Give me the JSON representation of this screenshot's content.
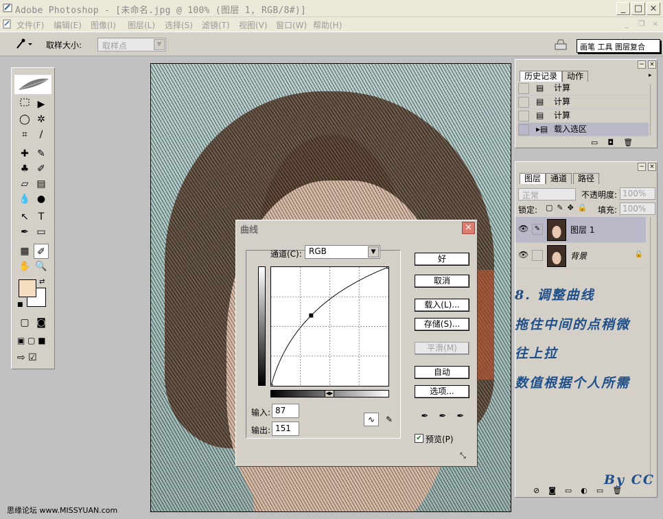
{
  "window": {
    "title": "Adobe Photoshop - [未命名.jpg @ 100% (图层 1, RGB/8#)]",
    "min_label": "_",
    "max_label": "□",
    "close_label": "×"
  },
  "menu": {
    "items": [
      "文件(F)",
      "编辑(E)",
      "图像(I)",
      "图层(L)",
      "选择(S)",
      "滤镜(T)",
      "视图(V)",
      "窗口(W)",
      "帮助(H)"
    ],
    "doc_controls": [
      "_",
      "❐",
      "×"
    ]
  },
  "options": {
    "sample_size_label": "取样大小:",
    "sample_size_value": "取样点",
    "well_tabs": "画笔 工具 图层复合"
  },
  "toolbox": {
    "colors": {
      "foreground": "#f5dcc0",
      "background": "#ffffff"
    }
  },
  "history": {
    "tabs": [
      "历史记录",
      "动作"
    ],
    "items": [
      "计算",
      "计算",
      "计算",
      "载入选区"
    ]
  },
  "layers": {
    "tabs": [
      "图层",
      "通道",
      "路径"
    ],
    "blend_mode": "正常",
    "opacity_label": "不透明度:",
    "opacity_value": "100%",
    "lock_label": "锁定:",
    "fill_label": "填充:",
    "fill_value": "100%",
    "rows": [
      {
        "name": "图层 1",
        "selected": true
      },
      {
        "name": "背景",
        "selected": false
      }
    ]
  },
  "annotations": {
    "lines": [
      "8. 调整曲线",
      "拖住中间的点稍微",
      "往上拉",
      "数值根据个人所需"
    ],
    "signature": "By CC"
  },
  "curves": {
    "title": "曲线",
    "channel_label": "通道(C):",
    "channel_value": "RGB",
    "input_label": "输入:",
    "input_value": "87",
    "output_label": "输出:",
    "output_value": "151",
    "buttons": {
      "ok": "好",
      "cancel": "取消",
      "load": "载入(L)...",
      "save": "存储(S)...",
      "smooth": "平滑(M)",
      "auto": "自动",
      "options": "选项..."
    },
    "preview_label": "预览(P)",
    "preview_checked": true,
    "curve_points": [
      [
        0,
        0
      ],
      [
        87,
        151
      ],
      [
        255,
        255
      ]
    ]
  },
  "watermark": "思缘论坛  www.MISSYUAN.com"
}
